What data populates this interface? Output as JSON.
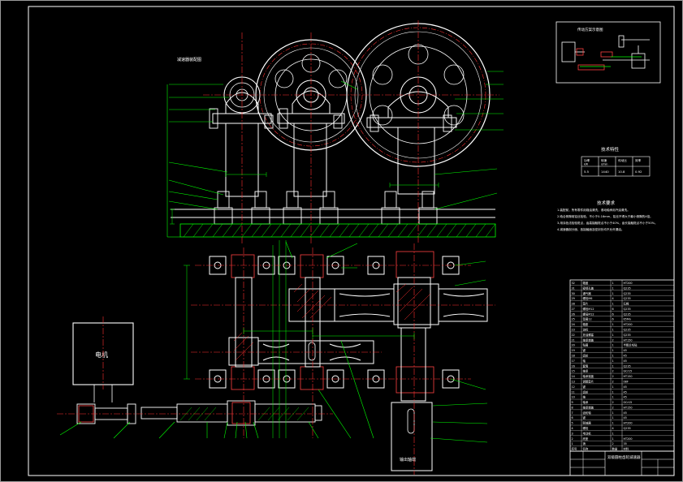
{
  "drawing": {
    "top_view_title": "减速器装配图",
    "motor_label": "电机",
    "output_label": "输出轴端",
    "tech_params_title": "技术特性",
    "tech_params_table": {
      "headers": [
        "功率",
        "转速",
        "传动比",
        "效率"
      ],
      "units": [
        "kW",
        "r/min",
        "",
        ""
      ],
      "values": [
        "5.5",
        "1440",
        "10.8",
        "0.92"
      ]
    },
    "tech_requirements_title": "技术要求",
    "tech_requirements": [
      "1.装配前，所有零件用煤油清洗，滚动轴承用汽油清洗。",
      "2.啮合侧隙用铅丝检验，不小于0.16mm，铅丝不得大于最小侧隙的4倍。",
      "3.用涂色法检验斑点，齿高接触斑点不小于40%，齿长接触斑点不小于50%。",
      "4.减速器剖分面、各接触面及密封处均不允许漏油。"
    ],
    "title_block_caption": "双级圆柱齿轮减速器",
    "bom_rows": [
      [
        "32",
        "箱盖",
        "1",
        "HT200"
      ],
      [
        "31",
        "窥视孔盖",
        "1",
        "Q235"
      ],
      [
        "30",
        "通气器",
        "1",
        "Q235"
      ],
      [
        "29",
        "螺栓M6",
        "4",
        "Q235"
      ],
      [
        "28",
        "垫片",
        "1",
        "石棉"
      ],
      [
        "27",
        "螺栓M12",
        "6",
        "Q235"
      ],
      [
        "26",
        "螺母M12",
        "6",
        "Q235"
      ],
      [
        "25",
        "垫圈12",
        "6",
        "65Mn"
      ],
      [
        "24",
        "箱座",
        "1",
        "HT200"
      ],
      [
        "23",
        "油标",
        "1",
        "Q235"
      ],
      [
        "22",
        "放油螺塞",
        "1",
        "Q235"
      ],
      [
        "21",
        "轴承端盖",
        "2",
        "HT150"
      ],
      [
        "20",
        "毡圈",
        "1",
        "半粗羊毛毡"
      ],
      [
        "19",
        "键",
        "1",
        "45"
      ],
      [
        "18",
        "齿轮",
        "1",
        "45"
      ],
      [
        "17",
        "轴",
        "1",
        "45"
      ],
      [
        "16",
        "套筒",
        "1",
        "Q235"
      ],
      [
        "15",
        "轴承",
        "2",
        "GCr15"
      ],
      [
        "14",
        "轴承端盖",
        "2",
        "HT150"
      ],
      [
        "13",
        "调整垫片",
        "2",
        "08F"
      ],
      [
        "12",
        "键",
        "1",
        "45"
      ],
      [
        "11",
        "齿轮",
        "1",
        "45"
      ],
      [
        "10",
        "轴",
        "1",
        "45"
      ],
      [
        "9",
        "轴承",
        "2",
        "GCr15"
      ],
      [
        "8",
        "轴承端盖",
        "2",
        "HT150"
      ],
      [
        "7",
        "齿轮轴",
        "1",
        "45"
      ],
      [
        "6",
        "键",
        "1",
        "45"
      ],
      [
        "5",
        "联轴器",
        "1",
        "HT200"
      ],
      [
        "4",
        "螺栓",
        "4",
        "Q235"
      ],
      [
        "3",
        "电动机",
        "1",
        ""
      ],
      [
        "2",
        "底座",
        "1",
        "HT200"
      ],
      [
        "1",
        "销",
        "2",
        "35"
      ]
    ],
    "bom_headers": [
      "序号",
      "名称",
      "数量",
      "材料"
    ]
  },
  "colors": {
    "background": "#000000",
    "border": "#ffffff",
    "outline": "#ffffff",
    "centerline": "#ff3030",
    "leader": "#00ff00",
    "bearing": "#ff4040",
    "dimension": "#00ff00"
  }
}
